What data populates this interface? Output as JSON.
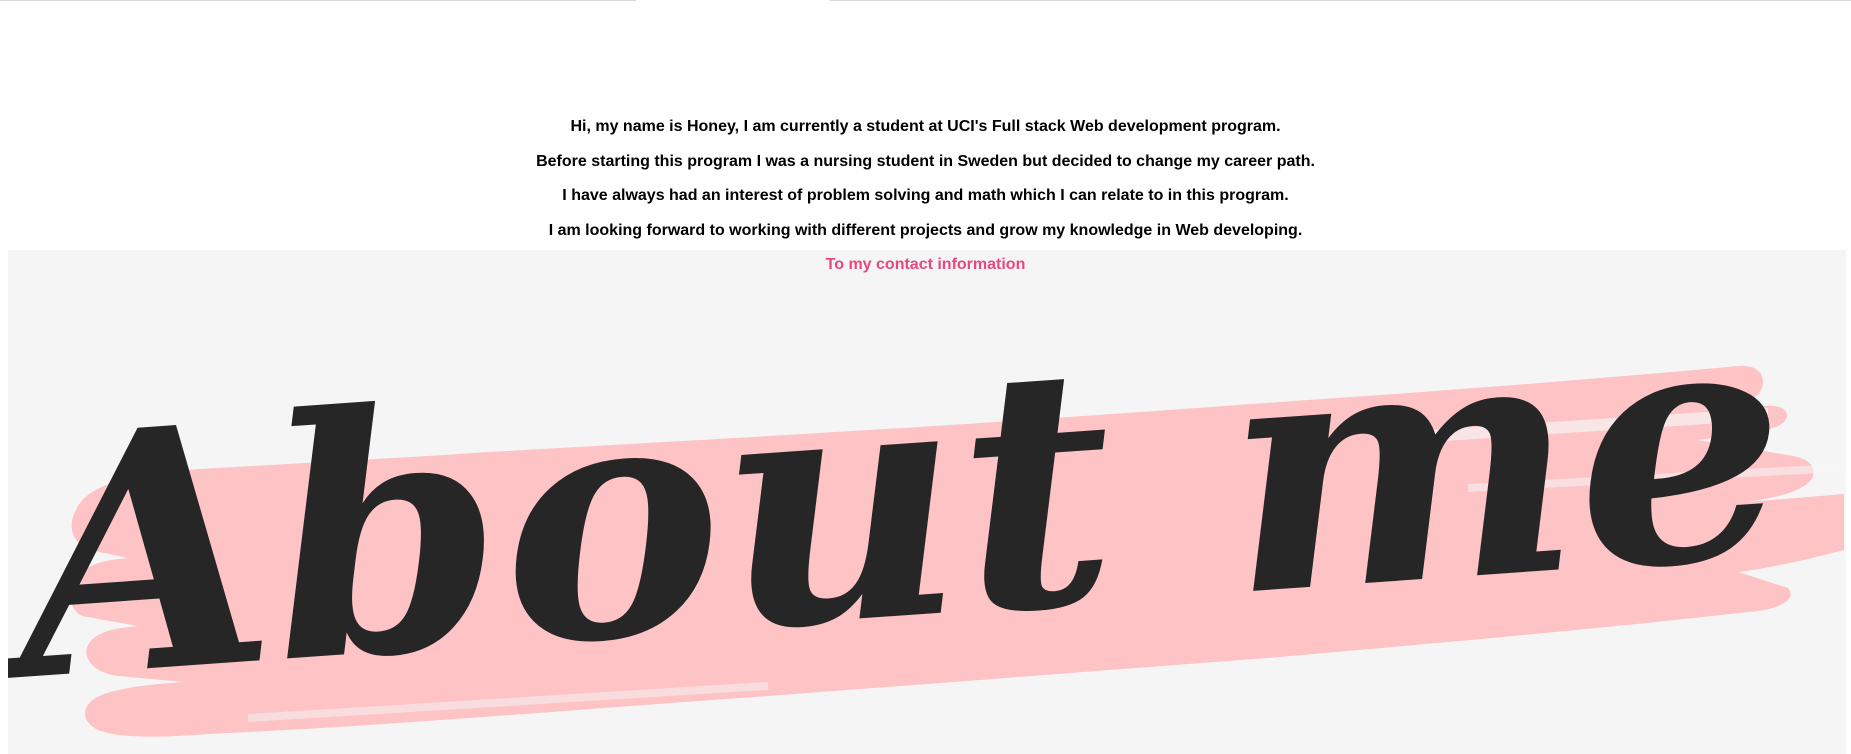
{
  "about": {
    "paragraphs": [
      "Hi, my name is Honey, I am currently a student at UCI's Full stack Web development program.",
      "Before starting this program I was a nursing student in Sweden but decided to change my career path.",
      "I have always had an interest of problem solving and math which I can relate to in this program.",
      "I am looking forward to working with different projects and grow my knowledge in Web developing."
    ],
    "contact_link": "To my contact information",
    "link_color": "#e8487e"
  },
  "banner": {
    "title": "About me",
    "brush_color": "#fdc3c5",
    "text_color": "#262626"
  }
}
